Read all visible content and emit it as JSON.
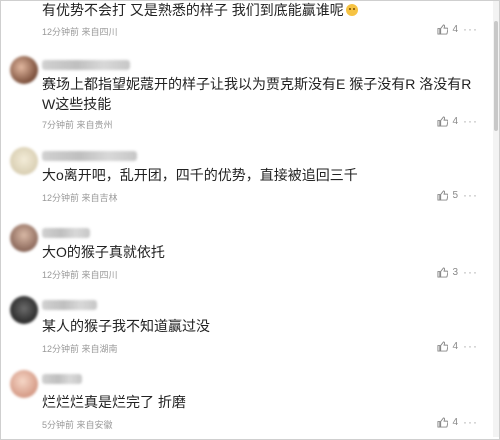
{
  "comments": [
    {
      "text": "有优势不会打 又是熟悉的样子 我们到底能赢谁呢",
      "meta": "12分钟前 来自四川",
      "likes": "4",
      "more": "···"
    },
    {
      "text": "赛场上都指望妮蔻开的样子让我以为贾克斯没有E 猴子没有R 洛没有R W这些技能",
      "meta": "7分钟前 来自贵州",
      "likes": "4",
      "more": "···"
    },
    {
      "text": "大o离开吧，乱开团，四千的优势，直接被追回三千",
      "meta": "12分钟前 来自吉林",
      "likes": "5",
      "more": "···"
    },
    {
      "text": "大O的猴子真就依托",
      "meta": "12分钟前 来自四川",
      "likes": "3",
      "more": "···"
    },
    {
      "text": "某人的猴子我不知道赢过没",
      "meta": "12分钟前 来自湖南",
      "likes": "4",
      "more": "···"
    },
    {
      "text": "烂烂烂真是烂完了 折磨",
      "meta": "5分钟前 来自安徽",
      "likes": "4",
      "more": "···"
    }
  ],
  "icons": {
    "like": "thumbs-up-icon",
    "more": "more-dots-icon",
    "emoji": "smile-emoji-icon"
  }
}
